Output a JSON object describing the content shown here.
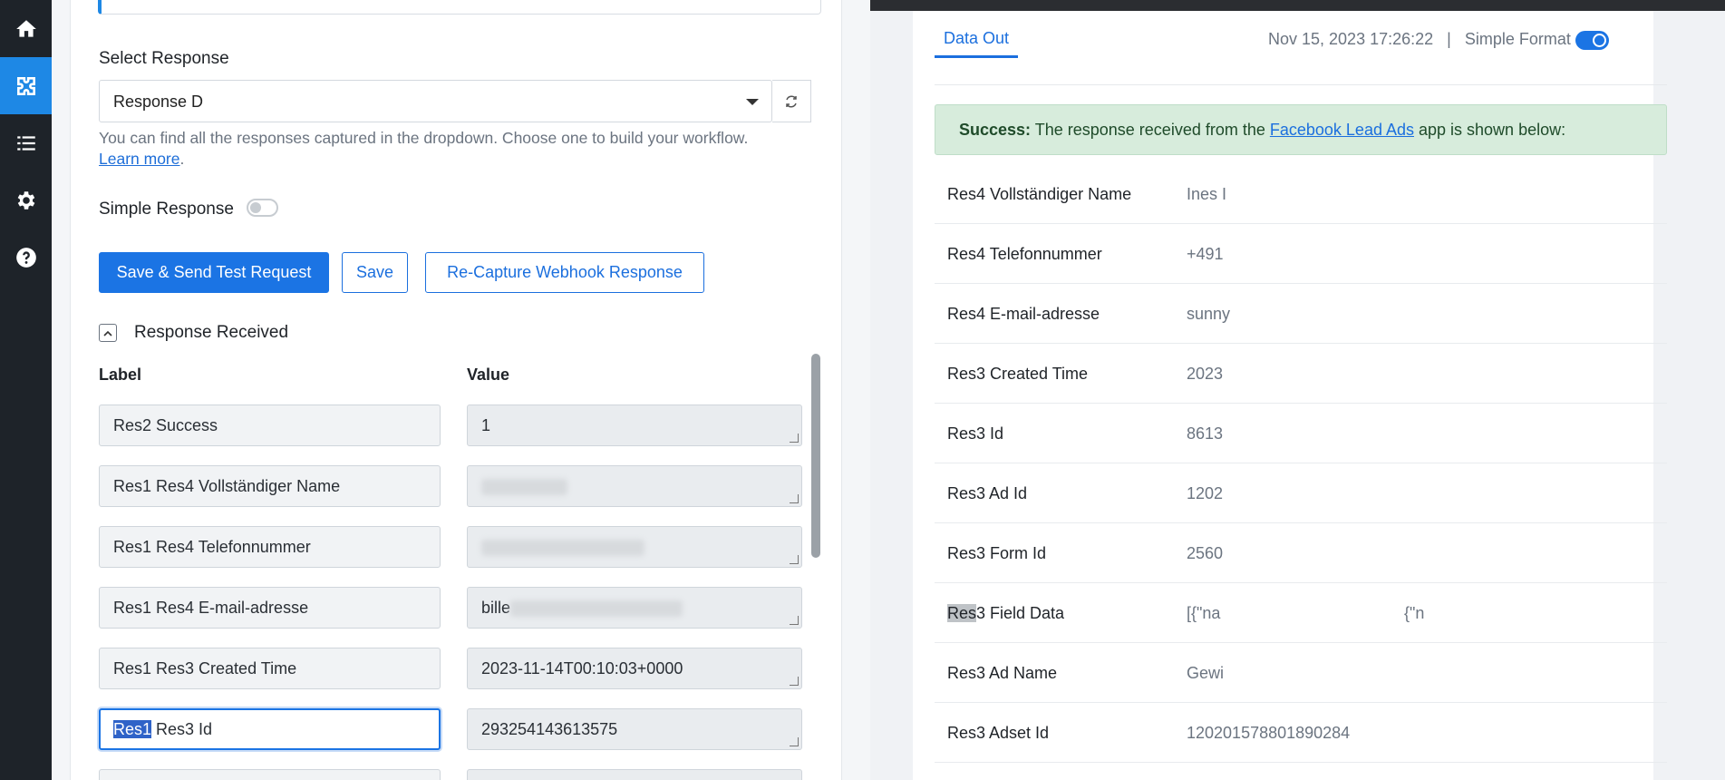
{
  "sidebar": {
    "icons": [
      "home-icon",
      "integrations-icon",
      "list-icon",
      "settings-icon",
      "help-icon"
    ],
    "active_index": 1
  },
  "left": {
    "select_label": "Select Response",
    "select_value": "Response D",
    "help_text": "You can find all the responses captured in the dropdown. Choose one to build your workflow.",
    "help_link": "Learn more",
    "simple_response_label": "Simple Response",
    "buttons": {
      "save_send": "Save & Send Test Request",
      "save": "Save",
      "recapture": "Re-Capture Webhook Response"
    },
    "response_received": "Response Received",
    "col_label": "Label",
    "col_value": "Value",
    "rows": [
      {
        "label": "Res2 Success",
        "value": "1"
      },
      {
        "label": "Res1 Res4 Vollständiger Name",
        "value": ""
      },
      {
        "label": "Res1 Res4 Telefonnummer",
        "value": ""
      },
      {
        "label": "Res1 Res4 E-mail-adresse",
        "value": "bille"
      },
      {
        "label": "Res1 Res3 Created Time",
        "value": "2023-11-14T00:10:03+0000"
      },
      {
        "label_highlight": "Res1",
        "label_rest": " Res3 Id",
        "value": "293254143613575"
      }
    ]
  },
  "right": {
    "tab": "Data Out",
    "timestamp": "Nov 15, 2023 17:26:22",
    "separator": "|",
    "format_label": "Simple Format",
    "alert": {
      "strong": "Success:",
      "before": " The response received from the ",
      "link": "Facebook Lead Ads",
      "after": " app is shown below:"
    },
    "rows": [
      {
        "key": "Res4 Vollständiger Name",
        "value": "Ines I"
      },
      {
        "key": "Res4 Telefonnummer",
        "value": "+491"
      },
      {
        "key": "Res4 E-mail-adresse",
        "value": "sunny"
      },
      {
        "key": "Res3 Created Time",
        "value": "2023"
      },
      {
        "key": "Res3 Id",
        "value": "8613"
      },
      {
        "key": "Res3 Ad Id",
        "value": "1202"
      },
      {
        "key": "Res3 Form Id",
        "value": "2560"
      },
      {
        "key_highlight": "Res",
        "key_rest": "3 Field Data",
        "value": "[{\"na",
        "value_end": "{\"n"
      },
      {
        "key": "Res3 Ad Name",
        "value": "Gewi"
      },
      {
        "key": "Res3 Adset Id",
        "value": "120201578801890284"
      }
    ]
  }
}
